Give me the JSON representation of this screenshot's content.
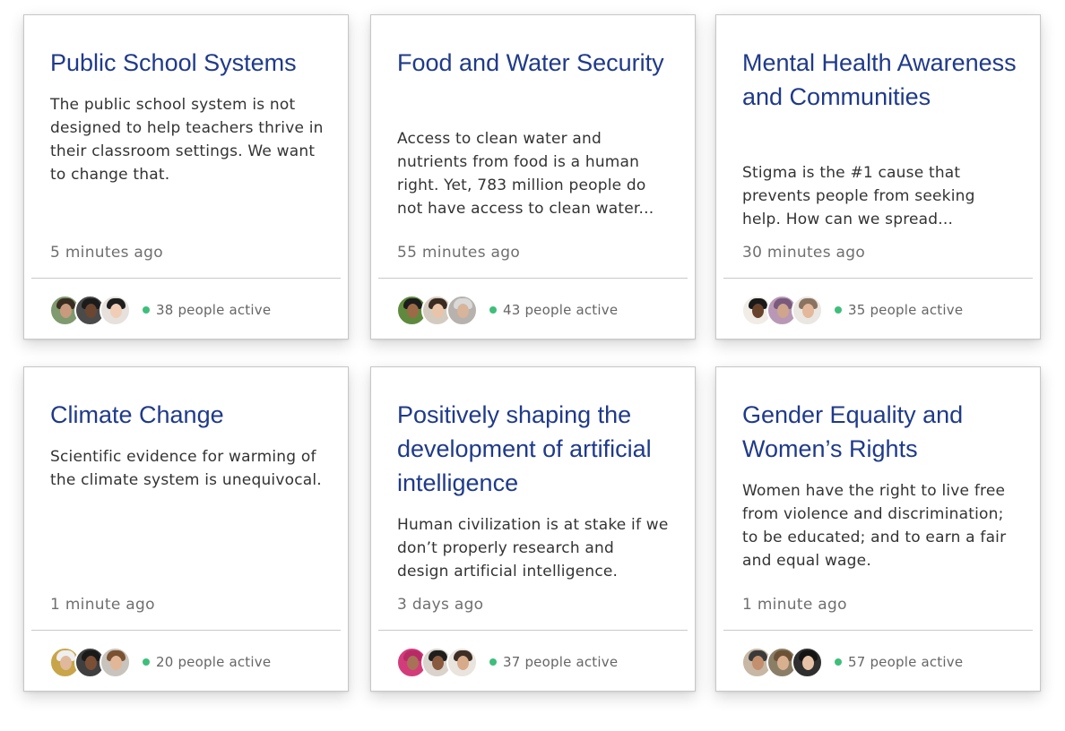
{
  "accent_color": "#1f3a8a",
  "active_dot_color": "#3dbf7a",
  "cards": [
    {
      "title": "Public School Systems",
      "description": "The public school system is not designed to help teachers thrive in their classroom settings. We want to change that.",
      "time": "5 minutes ago",
      "active": "38 people active",
      "avatars": [
        {
          "bg": "#7f9a6e",
          "hair": "#3b2c22",
          "face": "#c99a7d"
        },
        {
          "bg": "#4a4a4a",
          "hair": "#1b1b1b",
          "face": "#6b4631"
        },
        {
          "bg": "#e6e1dc",
          "hair": "#1e1e1e",
          "face": "#f0cdb4"
        }
      ]
    },
    {
      "title": "Food and Water Security",
      "description": "Access to clean water and nutrients from food is a human right. Yet, 783 million people do not have access to clean water...",
      "time": "55 minutes ago",
      "active": "43 people active",
      "avatars": [
        {
          "bg": "#5f8a3e",
          "hair": "#1c1c1c",
          "face": "#9c6a47"
        },
        {
          "bg": "#d4cbc0",
          "hair": "#3a2a20",
          "face": "#eac4a8"
        },
        {
          "bg": "#b7b2ad",
          "hair": "#d9d9d9",
          "face": "#d8b49a"
        }
      ]
    },
    {
      "title": "Mental Health Awareness and Communities",
      "description": "Stigma is the #1 cause that prevents people from seeking help. How can we spread...",
      "time": "30 minutes ago",
      "active": "35 people active",
      "avatars": [
        {
          "bg": "#f1ece6",
          "hair": "#1a1a1a",
          "face": "#6a432d"
        },
        {
          "bg": "#b998b6",
          "hair": "#7a5a7c",
          "face": "#cfa58c"
        },
        {
          "bg": "#eae6e1",
          "hair": "#8a7360",
          "face": "#e4b89b"
        }
      ]
    },
    {
      "title": "Climate Change",
      "description": "Scientific evidence for warming of the climate system is unequivocal.",
      "time": "1 minute ago",
      "active": "20 people active",
      "avatars": [
        {
          "bg": "#c9a54a",
          "hair": "#efefef",
          "face": "#e0b99c"
        },
        {
          "bg": "#3f3f3f",
          "hair": "#1a1a1a",
          "face": "#7a4f35"
        },
        {
          "bg": "#c8c3bc",
          "hair": "#7a5232",
          "face": "#e1b798"
        }
      ]
    },
    {
      "title": "Positively shaping the development of artificial intelligence",
      "description": "Human civilization is at stake if we don’t properly research and design artificial intelligence.",
      "time": "3 days ago",
      "active": "37 people active",
      "avatars": [
        {
          "bg": "#d33c7a",
          "hair": "#b82a66",
          "face": "#a87258"
        },
        {
          "bg": "#d9d3cc",
          "hair": "#1e1e1e",
          "face": "#8a5a3e"
        },
        {
          "bg": "#e9e4de",
          "hair": "#3d2e24",
          "face": "#d7aa8a"
        }
      ]
    },
    {
      "title": "Gender Equality and Women’s Rights",
      "description": "Women have the right to live free from violence and discrimination; to be educated; and to earn a fair and equal wage.",
      "time": "1 minute ago",
      "active": "57 people active",
      "avatars": [
        {
          "bg": "#c7b7a4",
          "hair": "#3a3a3a",
          "face": "#c48f6d"
        },
        {
          "bg": "#8a7f66",
          "hair": "#6b5237",
          "face": "#d9b08f"
        },
        {
          "bg": "#2f2f2f",
          "hair": "#141414",
          "face": "#e6c2a6"
        }
      ]
    }
  ]
}
